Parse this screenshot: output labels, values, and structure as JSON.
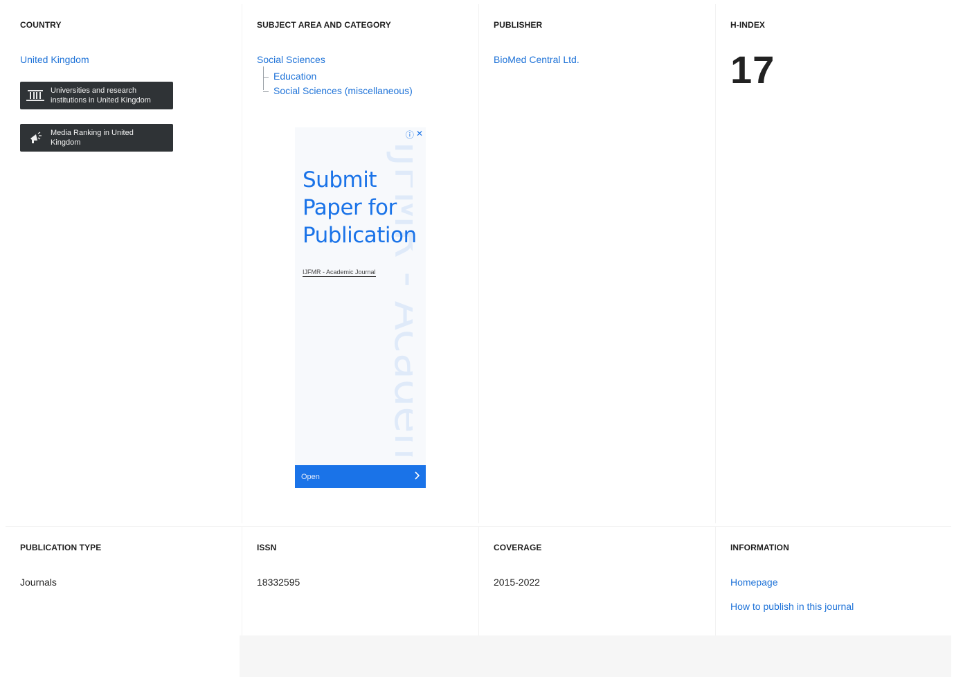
{
  "country": {
    "heading": "COUNTRY",
    "value": "United Kingdom",
    "universities_button": "Universities and research institutions in United Kingdom",
    "media_button": "Media Ranking in United Kingdom",
    "universities_icon": "institution-icon",
    "media_icon": "megaphone-icon"
  },
  "subject": {
    "heading": "SUBJECT AREA AND CATEGORY",
    "area": "Social Sciences",
    "categories": [
      "Education",
      "Social Sciences (miscellaneous)"
    ]
  },
  "publisher": {
    "heading": "PUBLISHER",
    "value": "BioMed Central Ltd."
  },
  "hindex": {
    "heading": "H-INDEX",
    "value": "17"
  },
  "ad": {
    "headline": "Submit Paper for Publication",
    "source": "IJFMR - Academic Journal",
    "open_label": "Open",
    "watermark": "IJFMR - Academic",
    "accent": "#1a73e8"
  },
  "publication_type": {
    "heading": "PUBLICATION TYPE",
    "value": "Journals"
  },
  "issn": {
    "heading": "ISSN",
    "value": "18332595"
  },
  "coverage": {
    "heading": "COVERAGE",
    "value": "2015-2022"
  },
  "information": {
    "heading": "INFORMATION",
    "homepage": "Homepage",
    "how_to_publish": "How to publish in this journal"
  },
  "colors": {
    "link": "#1f73d8",
    "dark_button": "#2f3336"
  }
}
